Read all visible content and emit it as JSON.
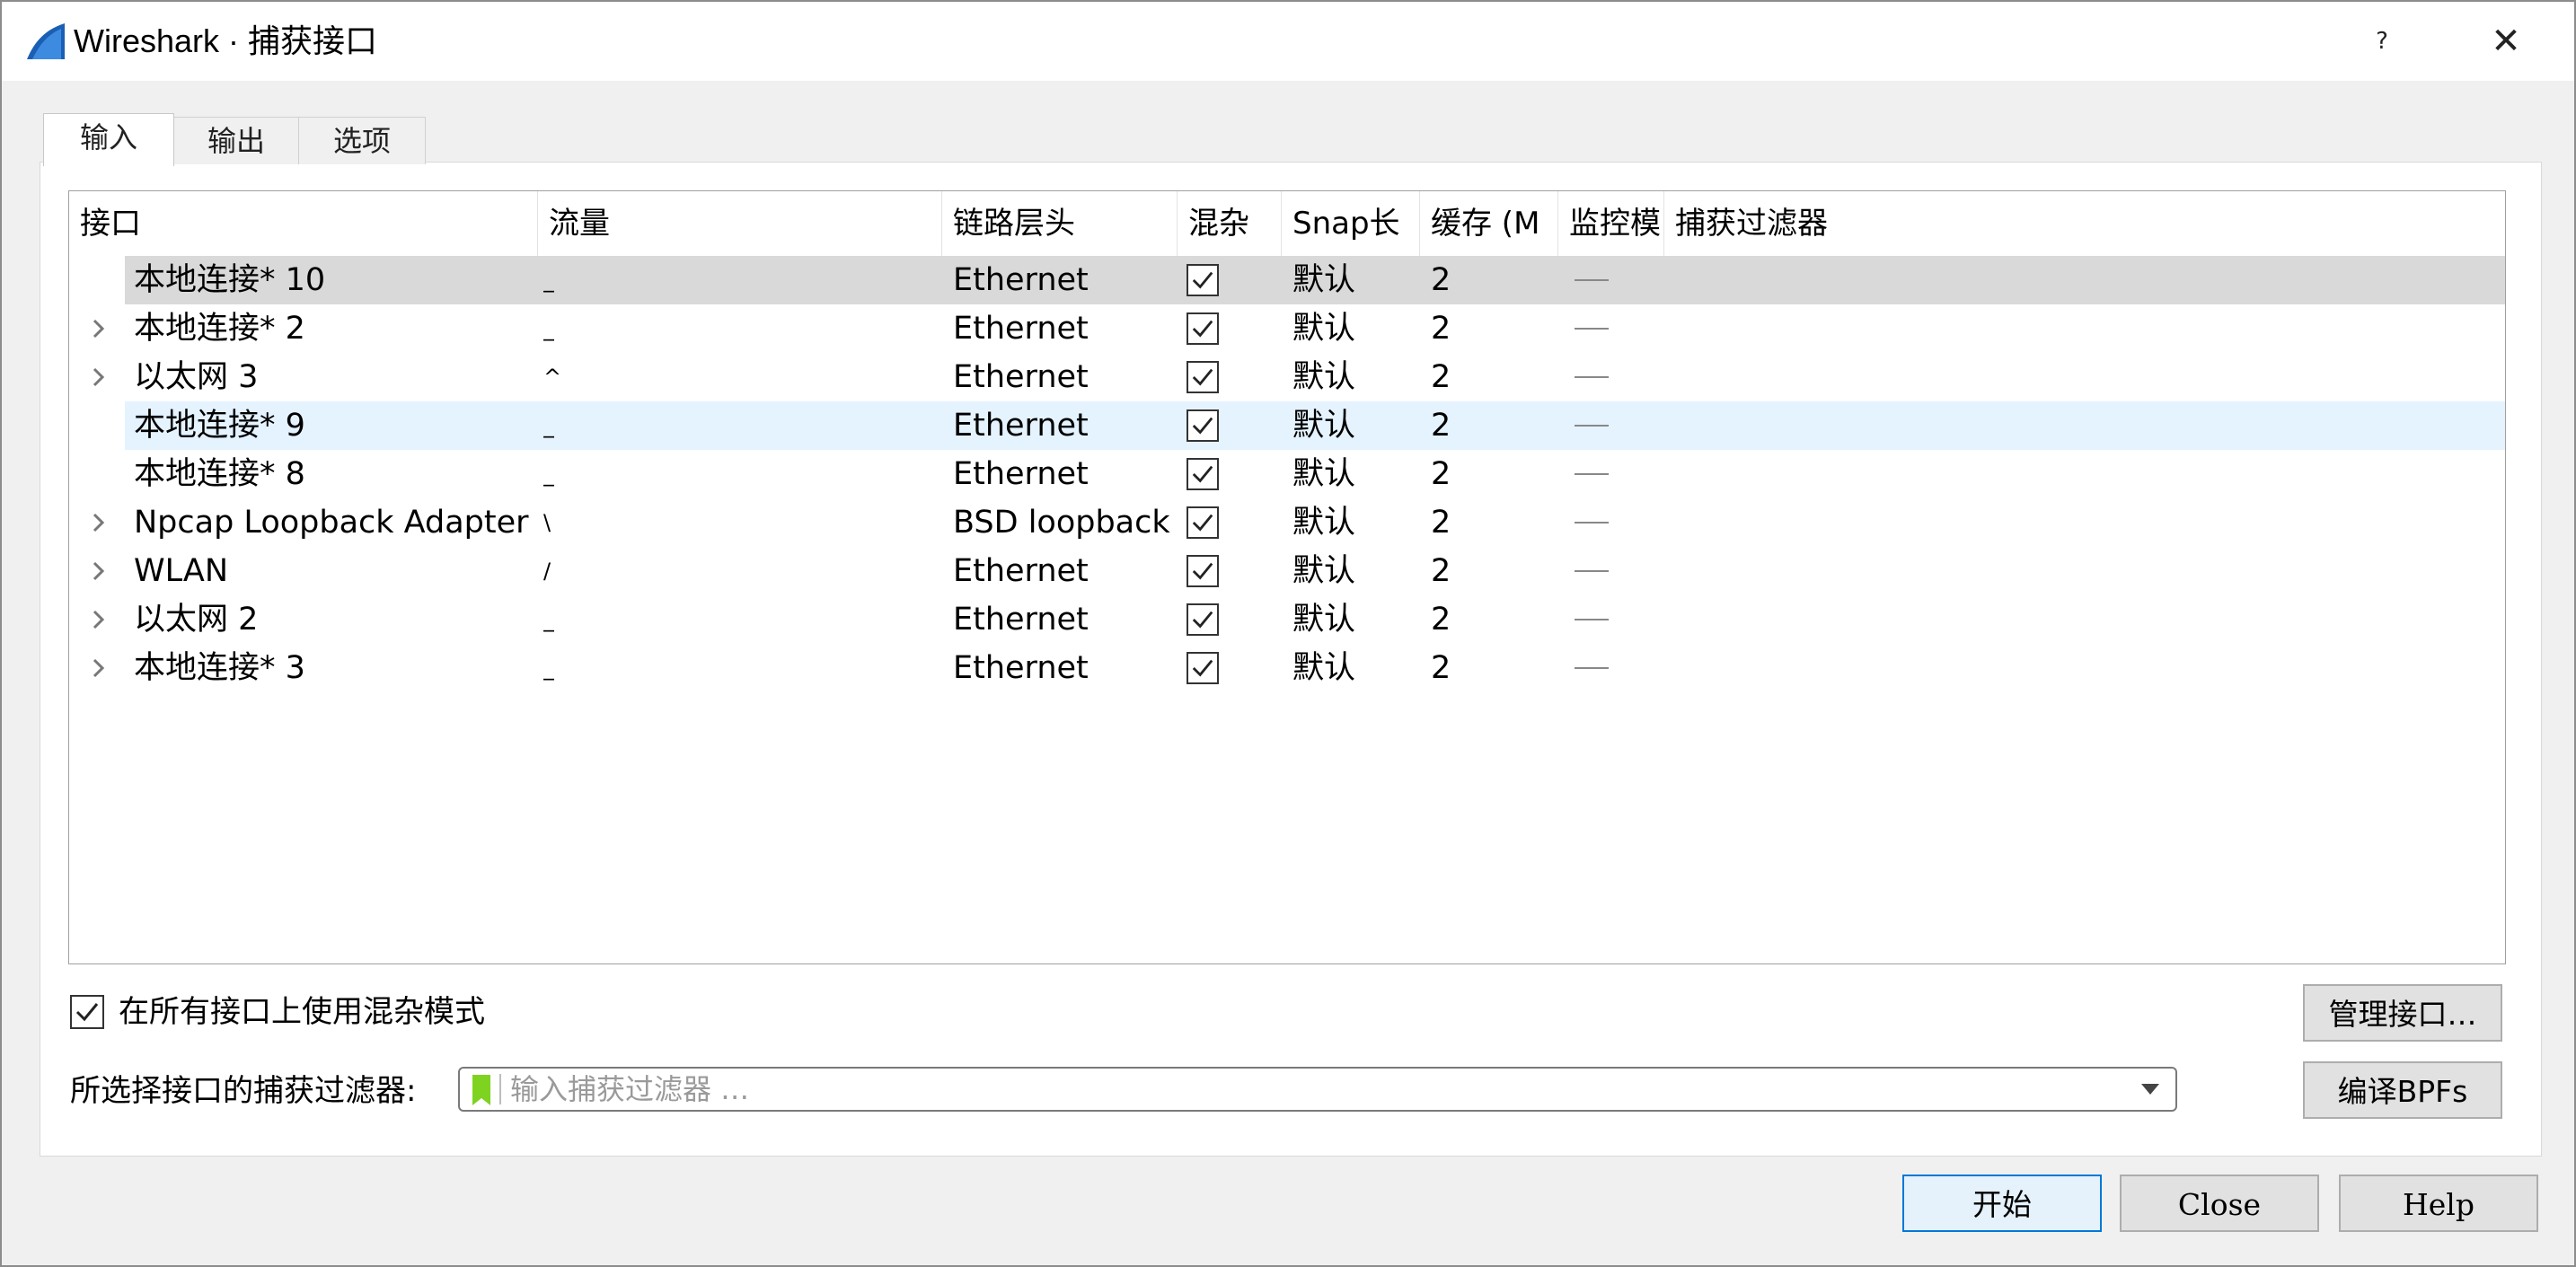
{
  "window": {
    "title": "Wireshark · 捕获接口",
    "help_label": "?",
    "close_label": "✕"
  },
  "tabs": [
    {
      "label": "输入",
      "active": true
    },
    {
      "label": "输出",
      "active": false
    },
    {
      "label": "选项",
      "active": false
    }
  ],
  "table": {
    "columns": [
      "接口",
      "流量",
      "链路层头",
      "混杂",
      "Snap长",
      "缓存 (M",
      "监控模",
      "捕获过滤器"
    ],
    "rows": [
      {
        "interface": "本地连接* 10",
        "traffic": "_",
        "link": "Ethernet",
        "promisc": true,
        "snap": "默认",
        "buffer": "2",
        "monitor": "—",
        "expandable": false,
        "state": "selected"
      },
      {
        "interface": "本地连接* 2",
        "traffic": "_",
        "link": "Ethernet",
        "promisc": true,
        "snap": "默认",
        "buffer": "2",
        "monitor": "—",
        "expandable": true,
        "state": ""
      },
      {
        "interface": "以太网 3",
        "traffic": "^",
        "link": "Ethernet",
        "promisc": true,
        "snap": "默认",
        "buffer": "2",
        "monitor": "—",
        "expandable": true,
        "state": ""
      },
      {
        "interface": "本地连接* 9",
        "traffic": "_",
        "link": "Ethernet",
        "promisc": true,
        "snap": "默认",
        "buffer": "2",
        "monitor": "—",
        "expandable": false,
        "state": "hover"
      },
      {
        "interface": "本地连接* 8",
        "traffic": "_",
        "link": "Ethernet",
        "promisc": true,
        "snap": "默认",
        "buffer": "2",
        "monitor": "—",
        "expandable": false,
        "state": ""
      },
      {
        "interface": "Npcap Loopback Adapter",
        "traffic": "\\",
        "link": "BSD loopback",
        "promisc": true,
        "snap": "默认",
        "buffer": "2",
        "monitor": "—",
        "expandable": true,
        "state": ""
      },
      {
        "interface": "WLAN",
        "traffic": "/",
        "link": "Ethernet",
        "promisc": true,
        "snap": "默认",
        "buffer": "2",
        "monitor": "—",
        "expandable": true,
        "state": ""
      },
      {
        "interface": "以太网 2",
        "traffic": "_",
        "link": "Ethernet",
        "promisc": true,
        "snap": "默认",
        "buffer": "2",
        "monitor": "—",
        "expandable": true,
        "state": ""
      },
      {
        "interface": "本地连接* 3",
        "traffic": "_",
        "link": "Ethernet",
        "promisc": true,
        "snap": "默认",
        "buffer": "2",
        "monitor": "—",
        "expandable": true,
        "state": ""
      }
    ]
  },
  "options": {
    "promisc_all_label": "在所有接口上使用混杂模式",
    "promisc_all_checked": true,
    "filter_label": "所选择接口的捕获过滤器:",
    "filter_placeholder": "输入捕获过滤器 …",
    "filter_value": ""
  },
  "buttons": {
    "manage": "管理接口…",
    "compile": "编译BPFs",
    "start": "开始",
    "close": "Close",
    "help": "Help"
  },
  "colors": {
    "selected_row": "#d9d9d9",
    "hover_row": "#e5f3ff",
    "primary_border": "#0078d7",
    "bookmark_green": "#7ed321"
  }
}
